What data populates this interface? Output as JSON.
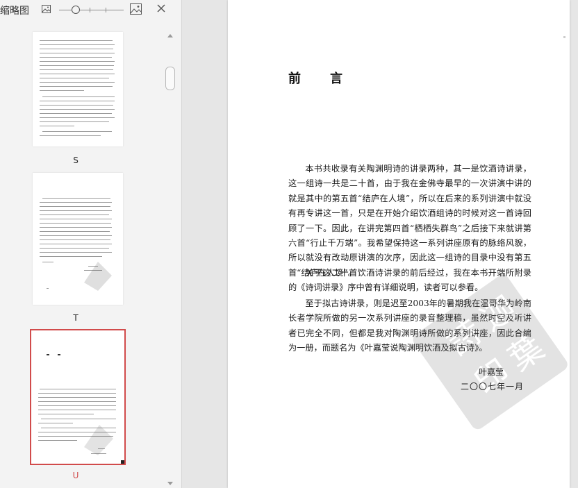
{
  "panel": {
    "title": "缩略图",
    "thumbnails": [
      {
        "label": "S",
        "selected": false
      },
      {
        "label": "T",
        "selected": false
      },
      {
        "label": "U",
        "selected": true
      }
    ]
  },
  "document": {
    "title": "前言",
    "paragraphs": [
      "本书共收录有关陶渊明诗的讲录两种，其一是饮酒诗讲录，这一组诗一共是二十首，由于我在金佛寺最早的一次讲演中讲的就是其中的第五首“结庐在人境”，所以在后来的系列讲演中就没有再专讲这一首，只是在开始介绍饮酒组诗的时候对这一首诗回顾了一下。因此，在讲完第四首“栖栖失群鸟”之后接下来就讲第六首“行止千万端”。我希望保持这一系列讲座原有的脉络风貌，所以就没有改动原讲演的次序，因此这一组诗的目录中没有第五首“结庐在人境”。",
      "关于这二十首饮酒诗讲录的前后经过，我在本书开端所附录的《诗词讲录》序中曾有详细说明，读者可以参看。",
      "至于拟古诗讲录，则是迟至2003年的暑期我在温哥华为岭南长者学院所做的另一次系列讲座的录音整理稿，虽然时空及听讲者已完全不同，但都是我对陶渊明诗所做的系列讲座，因此合编为一册，而题名为《叶嘉莹说陶渊明饮酒及拟古诗》。"
    ],
    "signature": "叶嘉莹",
    "date": "二〇〇七年一月"
  },
  "colors": {
    "selected": "#d14b4b",
    "panel_bg": "#f3f3f3",
    "workspace_bg": "#e6e6e6"
  }
}
